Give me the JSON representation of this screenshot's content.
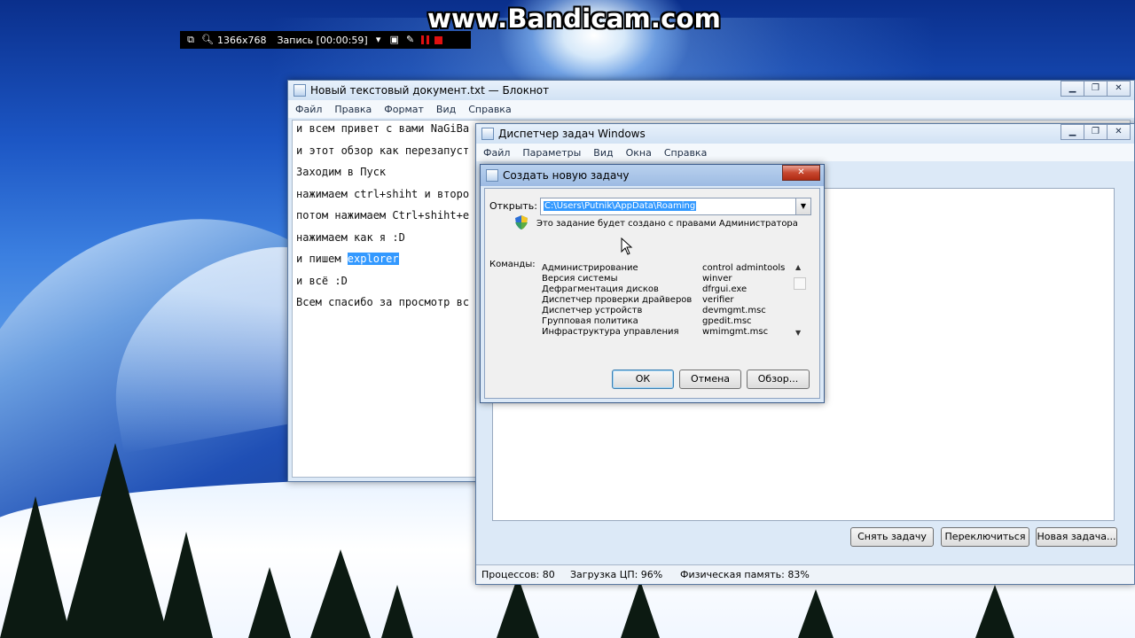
{
  "overlay": {
    "watermark": "www.Bandicam.com",
    "resolution": "1366x768",
    "record_status": "Запись [00:00:59]"
  },
  "notepad": {
    "title": "Новый текстовый документ.txt — Блокнот",
    "menu": [
      "Файл",
      "Правка",
      "Формат",
      "Вид",
      "Справка"
    ],
    "lines": [
      "и всем привет с вами NaGiBa",
      "и этот обзор как перезапуст",
      "Заходим в Пуск",
      "нажимаем ctrl+shiht и второ",
      "потом нажимаем Ctrl+shiht+e",
      "нажимаем как я :D",
      "и пишем ",
      "и всё :D",
      "Всем спасибо за просмотр вс"
    ],
    "selected_word": "explorer"
  },
  "taskmgr": {
    "title": "Диспетчер задач Windows",
    "menu": [
      "Файл",
      "Параметры",
      "Вид",
      "Окна",
      "Справка"
    ],
    "buttons": {
      "end_task": "Снять задачу",
      "switch_to": "Переключиться",
      "new_task": "Новая задача..."
    },
    "status": {
      "processes": "Процессов: 80",
      "cpu": "Загрузка ЦП: 96%",
      "memory": "Физическая память: 83%"
    }
  },
  "run_dialog": {
    "title": "Создать новую задачу",
    "open_label": "Открыть:",
    "open_value": "C:\\Users\\Putnik\\AppData\\Roaming",
    "admin_note": "Это задание будет создано с правами Администратора",
    "commands_label": "Команды:",
    "commands": [
      {
        "name": "Администрирование",
        "cmd": "control admintools"
      },
      {
        "name": "Версия системы",
        "cmd": "winver"
      },
      {
        "name": "Дефрагментация дисков",
        "cmd": "dfrgui.exe"
      },
      {
        "name": "Диспетчер проверки драйверов",
        "cmd": "verifier"
      },
      {
        "name": "Диспетчер устройств",
        "cmd": "devmgmt.msc"
      },
      {
        "name": "Групповая политика",
        "cmd": "gpedit.msc"
      },
      {
        "name": "Инфраструктура управления",
        "cmd": "wmimgmt.msc"
      }
    ],
    "buttons": {
      "ok": "ОК",
      "cancel": "Отмена",
      "browse": "Обзор..."
    }
  }
}
